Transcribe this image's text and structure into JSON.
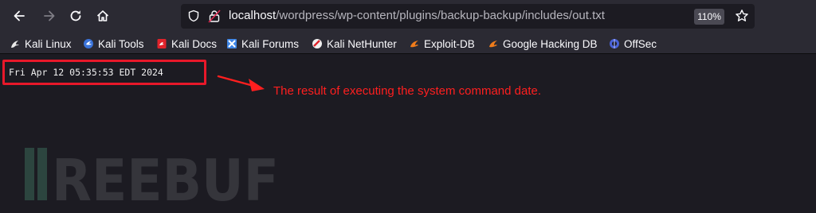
{
  "toolbar": {
    "url_host": "localhost",
    "url_path": "/wordpress/wp-content/plugins/backup-backup/includes/out.txt",
    "zoom": "110%"
  },
  "bookmarks": [
    {
      "label": "Kali Linux",
      "icon": "kali-dragon-icon"
    },
    {
      "label": "Kali Tools",
      "icon": "kali-tools-icon"
    },
    {
      "label": "Kali Docs",
      "icon": "kali-docs-icon"
    },
    {
      "label": "Kali Forums",
      "icon": "kali-forums-icon"
    },
    {
      "label": "Kali NetHunter",
      "icon": "kali-nethunter-icon"
    },
    {
      "label": "Exploit-DB",
      "icon": "exploit-db-icon"
    },
    {
      "label": "Google Hacking DB",
      "icon": "google-hacking-db-icon"
    },
    {
      "label": "OffSec",
      "icon": "offsec-icon"
    }
  ],
  "content": {
    "output": "Fri Apr 12 05:35:53 EDT 2024",
    "annotation": "The result of executing the system command date.",
    "watermark": "FREEBUF"
  },
  "colors": {
    "annotation": "#ff1f1f",
    "highlight": "#e8182a"
  }
}
